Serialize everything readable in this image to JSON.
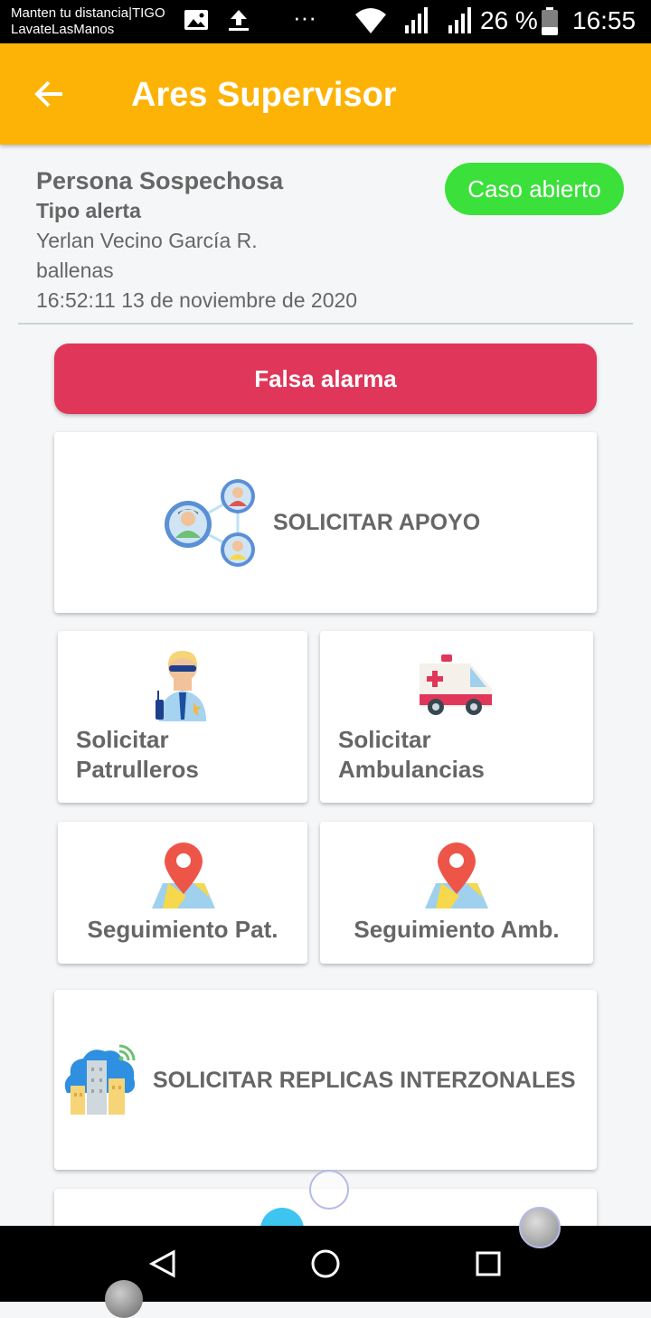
{
  "status_bar": {
    "notification_line1": "Manten tu distancia|TIGO",
    "notification_line2": "LavateLasManos",
    "more": "···",
    "battery_percent": "26 %",
    "time": "16:55"
  },
  "app_bar": {
    "title": "Ares Supervisor"
  },
  "alert": {
    "title": "Persona Sospechosa",
    "type_label": "Tipo alerta",
    "reporter": "Yerlan Vecino García R.",
    "location": "ballenas",
    "timestamp": "16:52:11 13 de noviembre de 2020",
    "status": "Caso abierto",
    "status_color": "#3be03b"
  },
  "actions": {
    "false_alarm": "Falsa alarma",
    "request_support": "SOLICITAR APOYO",
    "request_patrols_line1": "Solicitar",
    "request_patrols_line2": "Patrulleros",
    "request_ambulances_line1": "Solicitar",
    "request_ambulances_line2": "Ambulancias",
    "track_patrols": "Seguimiento Pat.",
    "track_ambulances": "Seguimiento Amb.",
    "request_replicas": "SOLICITAR REPLICAS INTERZONALES"
  },
  "colors": {
    "accent": "#fdb306",
    "danger": "#e0365a"
  }
}
